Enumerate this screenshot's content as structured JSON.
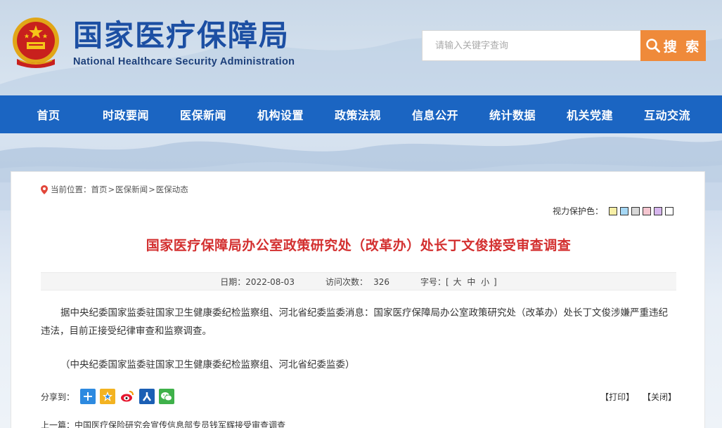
{
  "header": {
    "logo_cn": "国家医疗保障局",
    "logo_en": "National Healthcare Security Administration",
    "search_placeholder": "请输入关键字查询",
    "search_button": "搜 索"
  },
  "nav": [
    "首页",
    "时政要闻",
    "医保新闻",
    "机构设置",
    "政策法规",
    "信息公开",
    "统计数据",
    "机关党建",
    "互动交流"
  ],
  "breadcrumb": {
    "prefix": "当前位置：",
    "items": [
      "首页",
      "医保新闻",
      "医保动态"
    ]
  },
  "eye_care": {
    "label": "视力保护色：",
    "colors": [
      "#f7efa6",
      "#a6d8f5",
      "#d8d8d8",
      "#f5c6d0",
      "#d7b6ee",
      "#ffffff"
    ]
  },
  "article": {
    "title": "国家医疗保障局办公室政策研究处（改革办）处长丁文俊接受审查调查",
    "date_label": "日期：",
    "date": "2022-08-03",
    "views_label": "访问次数：",
    "views": "326",
    "fontsize_label": "字号：[",
    "fontsize_large": "大",
    "fontsize_medium": "中",
    "fontsize_small": "小",
    "fontsize_end": "]",
    "para1": "据中央纪委国家监委驻国家卫生健康委纪检监察组、河北省纪委监委消息：国家医疗保障局办公室政策研究处（改革办）处长丁文俊涉嫌严重违纪违法，目前正接受纪律审查和监察调查。",
    "para2": "（中央纪委国家监委驻国家卫生健康委纪检监察组、河北省纪委监委）"
  },
  "share": {
    "label": "分享到：",
    "print": "【打印】",
    "close": "【关闭】"
  },
  "prev": {
    "label": "上一篇：",
    "title": "中国医疗保险研究会宣传信息部专员钱军辉接受审查调查"
  }
}
